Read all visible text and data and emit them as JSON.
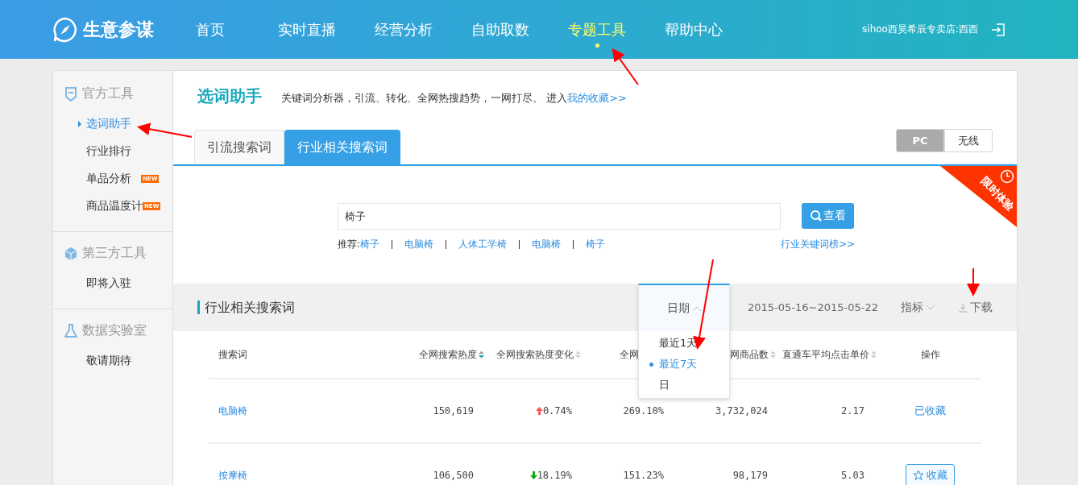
{
  "header": {
    "logo_text": "生意参谋",
    "nav": [
      {
        "label": "首页",
        "selected": false
      },
      {
        "label": "实时直播",
        "selected": false
      },
      {
        "label": "经营分析",
        "selected": false
      },
      {
        "label": "自助取数",
        "selected": false
      },
      {
        "label": "专题工具",
        "selected": true
      },
      {
        "label": "帮助中心",
        "selected": false
      }
    ],
    "user": "sihoo西昊希辰专卖店:西西"
  },
  "sidebar": {
    "sections": [
      {
        "title": "官方工具",
        "items": [
          {
            "label": "选词助手",
            "selected": true
          },
          {
            "label": "行业排行",
            "selected": false
          },
          {
            "label": "单品分析",
            "selected": false,
            "badge": "NEW"
          },
          {
            "label": "商品温度计",
            "selected": false,
            "badge": "NEW"
          }
        ]
      },
      {
        "title": "第三方工具",
        "items": [
          {
            "label": "即将入驻",
            "selected": false
          }
        ]
      },
      {
        "title": "数据实验室",
        "items": [
          {
            "label": "敬请期待",
            "selected": false
          }
        ]
      }
    ]
  },
  "main": {
    "title": "选词助手",
    "description": "关键词分析器，引流、转化、全网热搜趋势，一网打尽。",
    "link_prefix": "进入",
    "link": "我的收藏>>",
    "tabs": [
      {
        "label": "引流搜索词",
        "selected": false
      },
      {
        "label": "行业相关搜索词",
        "selected": true
      }
    ],
    "device_toggle": [
      {
        "label": "PC",
        "selected": true
      },
      {
        "label": "无线",
        "selected": false
      }
    ],
    "ribbon": "限时体验",
    "search": {
      "value": "椅子"
    },
    "search_button": "查看",
    "recommend_label": "推荐:",
    "recommendations": [
      "椅子",
      "电脑椅",
      "人体工学椅",
      "电脑椅",
      "椅子"
    ],
    "ranking_link": "行业关键词榜>>",
    "toolbar": {
      "title": "行业相关搜索词",
      "date_dropdown": {
        "label": "日期",
        "expanded": true,
        "options": [
          {
            "label": "最近1天",
            "selected": false
          },
          {
            "label": "最近7天",
            "selected": true
          },
          {
            "label": "日",
            "selected": false
          }
        ]
      },
      "date_range": "2015-05-16~2015-05-22",
      "metric_dropdown": "指标",
      "download": "下载"
    },
    "table": {
      "columns": [
        {
          "label": "搜索词",
          "sortable": false
        },
        {
          "label": "全网搜索热度",
          "sortable": true,
          "sorted": true
        },
        {
          "label": "全网搜索热度变化",
          "sortable": true,
          "sorted": false
        },
        {
          "label": "全网",
          "sortable": false
        },
        {
          "label": "网商品数",
          "sortable": true,
          "sorted": false
        },
        {
          "label": "直通车平均点击单价",
          "sortable": true,
          "sorted": false
        },
        {
          "label": "操作",
          "sortable": false
        }
      ],
      "rows": [
        {
          "keyword": "电脑椅",
          "heat": "150,619",
          "change": "0.74%",
          "rising": true,
          "column_4": "269.10%",
          "column_5": "3,732,024",
          "cpc": "2.17",
          "action": {
            "label": "已收藏",
            "kind": "saved"
          }
        },
        {
          "keyword": "按摩椅",
          "heat": "106,500",
          "change": "18.19%",
          "rising": false,
          "column_4": "151.23%",
          "column_5": "98,179",
          "cpc": "5.03",
          "action": {
            "label": "收藏",
            "kind": "button"
          }
        }
      ]
    }
  }
}
